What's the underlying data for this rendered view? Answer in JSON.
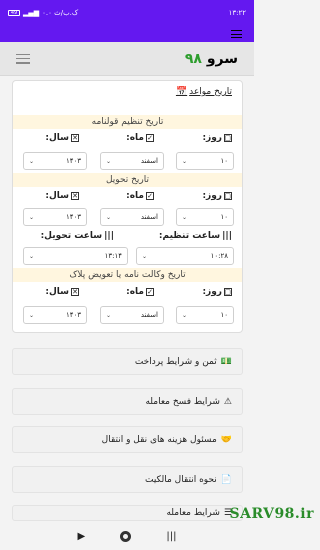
{
  "status": {
    "time": "۱۳:۲۲",
    "battery": "49",
    "net": "۰.۰ ک.ب/ث"
  },
  "header": {
    "brand": "سرو",
    "brand_num": "۹۸"
  },
  "card": {
    "title": "تاریخ مواعد",
    "sections": [
      {
        "title": "تاریخ تنظیم قولنامه"
      },
      {
        "title": "تاریخ تحویل"
      },
      {
        "title": "تاریخ وکالت نامه یا تعویض پلاک"
      }
    ],
    "labels": {
      "day": "روز:",
      "month": "ماه:",
      "year": "سال:",
      "time_set": "ساعت تنظیم:",
      "time_delivery": "ساعت تحویل:"
    },
    "rows": [
      {
        "day": "۱۰",
        "month": "اسفند",
        "year": "۱۴۰۳"
      },
      {
        "day": "۱۰",
        "month": "اسفند",
        "year": "۱۴۰۳",
        "time_set": "۱۰:۲۸",
        "time_delivery": "۱۳:۱۴"
      },
      {
        "day": "۱۰",
        "month": "اسفند",
        "year": "۱۴۰۳"
      }
    ]
  },
  "accordion": [
    {
      "label": "ثمن و شرایط پرداخت",
      "icon": "money-icon"
    },
    {
      "label": "شرایط فسخ معامله",
      "icon": "warning-icon"
    },
    {
      "label": "مسئول هزینه های نقل و انتقال",
      "icon": "handshake-icon"
    },
    {
      "label": "نحوه انتقال مالکیت",
      "icon": "document-icon"
    },
    {
      "label": "شرایط معامله",
      "icon": "list-icon"
    }
  ],
  "watermark": "SARV98.ir"
}
